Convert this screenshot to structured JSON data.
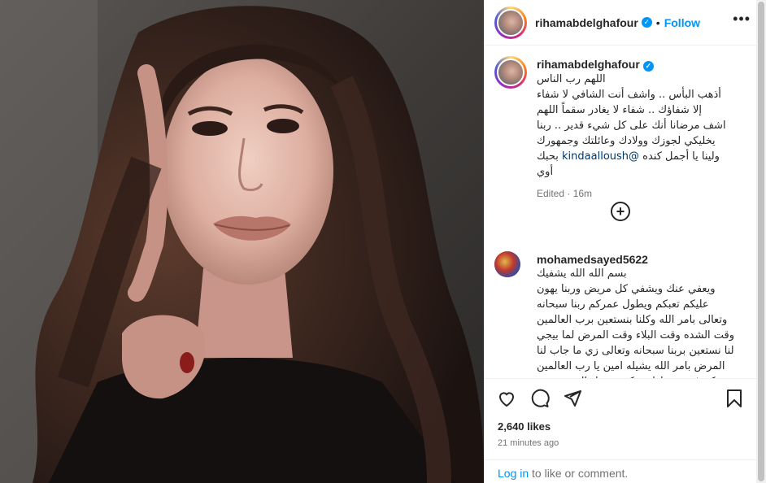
{
  "post": {
    "username": "rihamabdelghafour",
    "follow_label": "Follow",
    "separator": "•",
    "more_label": "•••",
    "caption": {
      "username": "rihamabdelghafour",
      "text_before_mention": "اللهم رب الناس\nأذهب البأس .. واشف أنت الشافي لا شفاء\nإلا شفاؤك .. شفاء لا يغادر سقماً اللهم\nاشف مرضانا أنك على كل شيء قدير .. ربنا\nيخليكي لجوزك وولادك وعائلتك وجمهورك\nولينا يا أجمل كنده ",
      "mention": "@kindaalloush",
      "text_after_mention": " بحبك\nأوي",
      "meta": "Edited · 16m"
    },
    "load_more_label": "+",
    "comment": {
      "username": "mohamedsayed5622",
      "text": "بسم الله الله يشفيك\nويعفي عنك ويشفي كل مريض وربنا يهون\nعليكم تعبكم ويطول عمركم ربنا سبحانه\nوتعالى بامر الله وكلنا بنستعين برب العالمين\nوقت الشده وقت البلاء وقت المرض لما بيجي\nلنا نستعين بربنا سبحانه وتعالى زي ما جاب لنا\nالمرض بامر الله يشيله امين يا رب العالمين\nيستركم في وسط اسرتكم ويجعل الفرحه جوه\nبيت كل انسان وكل ام اصيله عندها القوه"
    },
    "likes": "2,640 likes",
    "time_ago": "21 minutes ago",
    "login_label": "Log in",
    "login_suffix": " to like or comment."
  },
  "icons": {
    "verified": "✓",
    "like": "heart-icon",
    "comment": "comment-icon",
    "share": "share-icon",
    "save": "bookmark-icon"
  }
}
